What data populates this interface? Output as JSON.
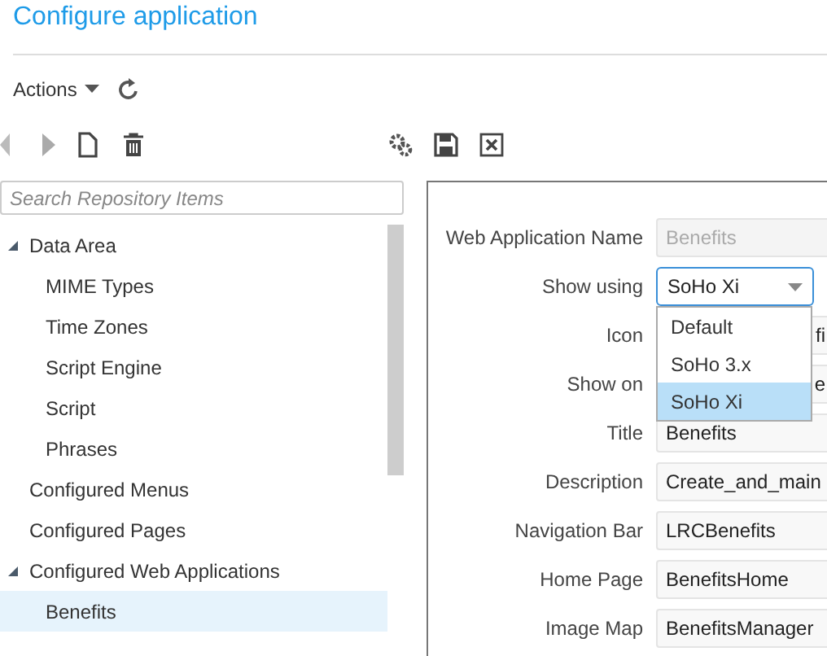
{
  "header": {
    "title": "Configure application"
  },
  "actions": {
    "label": "Actions"
  },
  "search": {
    "placeholder": "Search Repository Items"
  },
  "tree": [
    {
      "label": "Data Area",
      "expanded": true,
      "selected": false,
      "children": [
        {
          "label": "MIME Types",
          "selected": false
        },
        {
          "label": "Time Zones",
          "selected": false
        },
        {
          "label": "Script Engine",
          "selected": false
        },
        {
          "label": "Script",
          "selected": false
        },
        {
          "label": "Phrases",
          "selected": false
        }
      ]
    },
    {
      "label": "Configured Menus",
      "selected": false
    },
    {
      "label": "Configured Pages",
      "selected": false
    },
    {
      "label": "Configured Web Applications",
      "expanded": true,
      "selected": false,
      "children": [
        {
          "label": "Benefits",
          "selected": true
        }
      ]
    }
  ],
  "form": {
    "fields": [
      {
        "kind": "text",
        "label": "Web Application Name",
        "value": "Benefits",
        "disabled": true
      },
      {
        "kind": "select",
        "label": "Show using",
        "value": "SoHo Xi",
        "expanded": true,
        "options": [
          {
            "label": "Default",
            "selected": false
          },
          {
            "label": "SoHo 3.x",
            "selected": false
          },
          {
            "label": "SoHo Xi",
            "selected": true
          }
        ]
      },
      {
        "kind": "covered",
        "label": "Icon",
        "value": "fi"
      },
      {
        "kind": "covered",
        "label": "Show on",
        "value": "e"
      },
      {
        "kind": "text",
        "label": "Title",
        "value": "Benefits",
        "disabled": false
      },
      {
        "kind": "text",
        "label": "Description",
        "value": "Create_and_main",
        "disabled": false
      },
      {
        "kind": "text",
        "label": "Navigation Bar",
        "value": "LRCBenefits",
        "disabled": false
      },
      {
        "kind": "text",
        "label": "Home Page",
        "value": "BenefitsHome",
        "disabled": false
      },
      {
        "kind": "text",
        "label": "Image Map",
        "value": "BenefitsManager",
        "disabled": false
      }
    ]
  }
}
